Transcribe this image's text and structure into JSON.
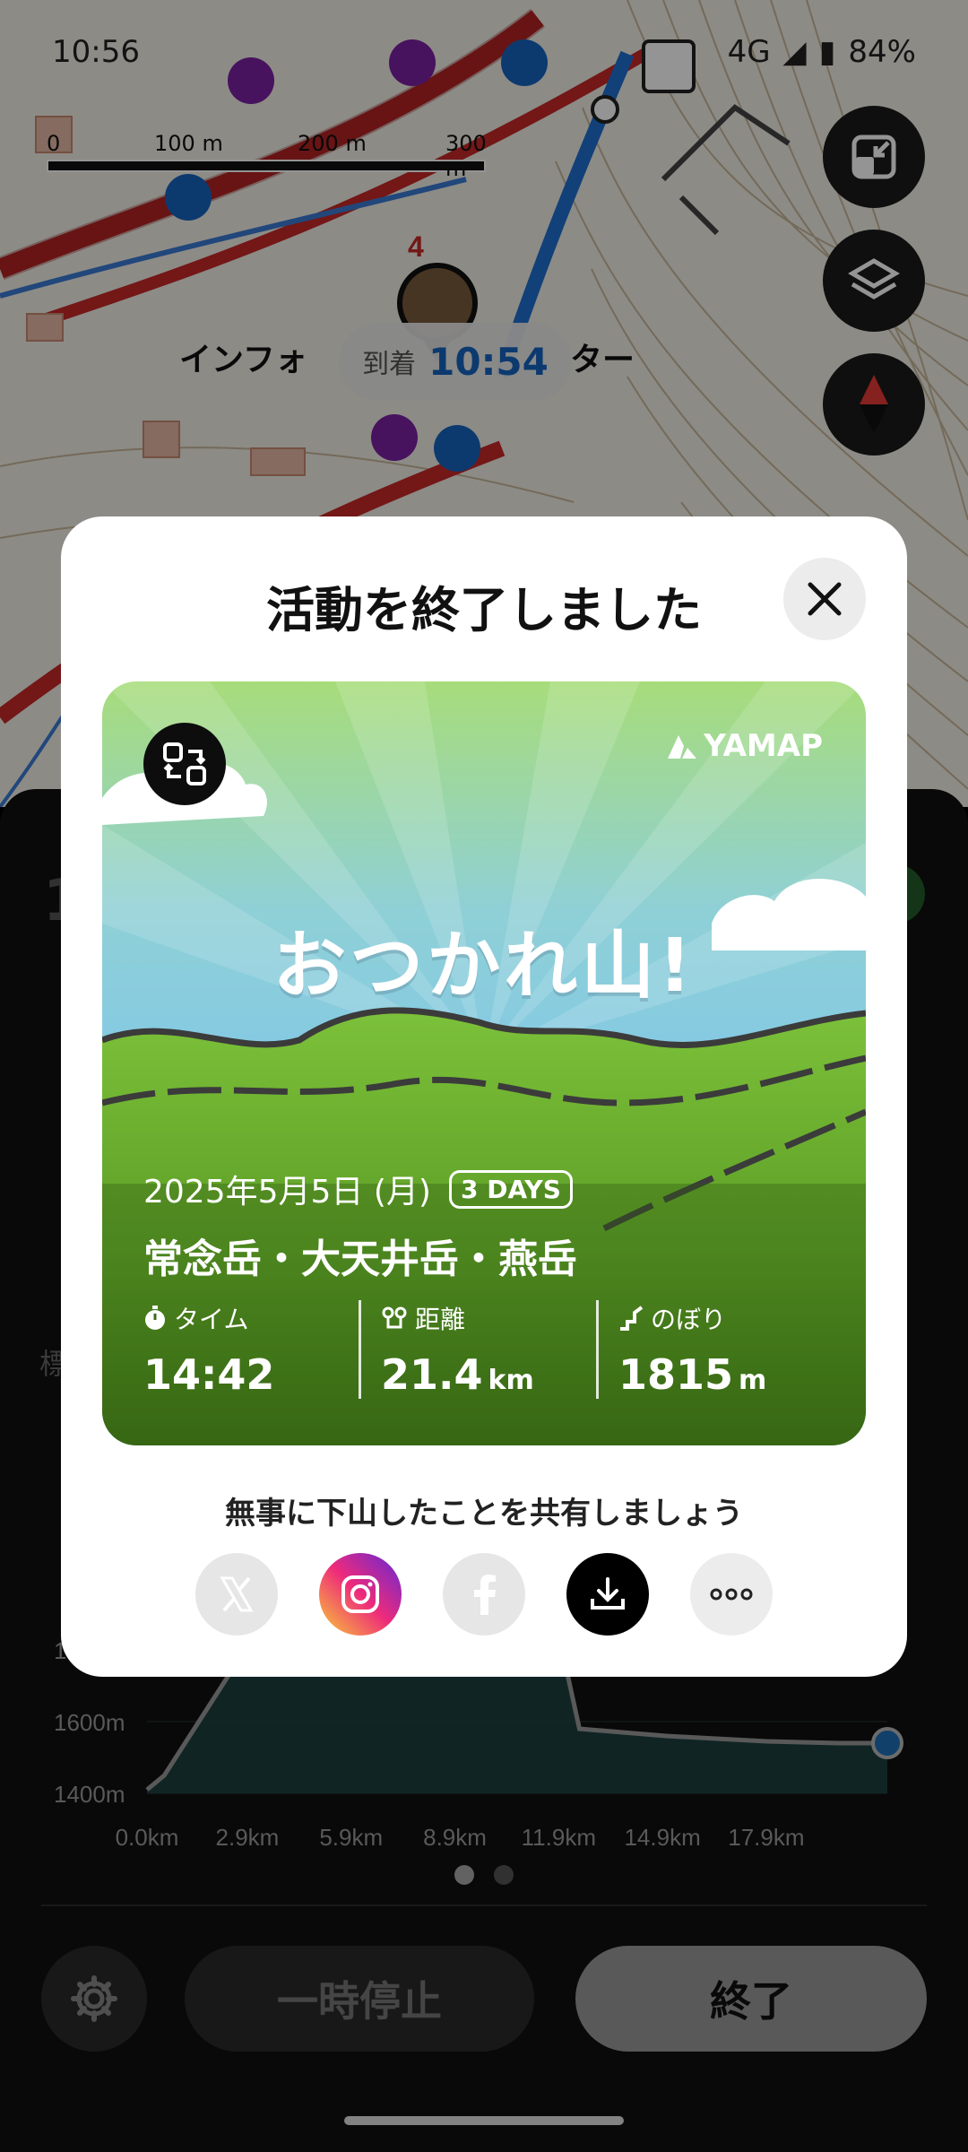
{
  "status_bar": {
    "time": "10:56",
    "network": "4G",
    "battery": "84%"
  },
  "map": {
    "scale_labels": [
      "0",
      "100 m",
      "200 m",
      "300 m"
    ],
    "arrival_label": "到着",
    "arrival_time": "10:54",
    "waypoint_number": "4",
    "place_label_left": "インフォ",
    "place_label_right": "ター",
    "buttons": [
      "collapse-icon",
      "layers-icon",
      "compass-icon"
    ]
  },
  "sheet": {
    "peek_number": "1",
    "peek_label": "標",
    "chart_data": {
      "type": "area",
      "title": "",
      "xlabel": "",
      "ylabel": "",
      "x_ticks": [
        "0.0km",
        "2.9km",
        "5.9km",
        "8.9km",
        "11.9km",
        "14.9km",
        "17.9km"
      ],
      "y_ticks": [
        "1400m",
        "1600m",
        "1800m"
      ],
      "x": [
        0.0,
        0.5,
        1.5,
        2.5,
        3.0,
        4.0,
        5.0,
        8.0,
        11.5,
        12.0,
        12.5,
        15.0,
        17.9,
        20.0,
        21.4
      ],
      "y": [
        1410,
        1450,
        1600,
        1750,
        1900,
        2100,
        2500,
        2700,
        2600,
        1800,
        1580,
        1560,
        1545,
        1540,
        1540
      ],
      "ylim": [
        1400,
        2000
      ],
      "xlim": [
        0,
        21.4
      ],
      "grid": true
    },
    "pager": {
      "count": 2,
      "active": 0
    },
    "pause_label": "一時停止",
    "end_label": "終了"
  },
  "modal": {
    "title": "活動を終了しました",
    "card": {
      "brand": "YAMAP",
      "headline": "おつかれ山!",
      "date": "2025年5月5日 (月)",
      "days_badge": "3 DAYS",
      "mountains": "常念岳・大天井岳・燕岳",
      "stats": [
        {
          "label": "タイム",
          "value": "14:42",
          "unit": "",
          "icon": "stopwatch-icon"
        },
        {
          "label": "距離",
          "value": "21.4",
          "unit": "km",
          "icon": "route-icon"
        },
        {
          "label": "のぼり",
          "value": "1815",
          "unit": "m",
          "icon": "ascent-icon"
        }
      ]
    },
    "share_prompt": "無事に下山したことを共有しましょう",
    "share_buttons": [
      {
        "icon": "x-icon",
        "color": "#e6e6e6"
      },
      {
        "icon": "instagram-icon",
        "color": "#e1306c"
      },
      {
        "icon": "facebook-icon",
        "color": "#e6e6e6"
      },
      {
        "icon": "download-icon",
        "color": "#000000"
      },
      {
        "icon": "more-icon",
        "color": "#ececec"
      }
    ]
  }
}
